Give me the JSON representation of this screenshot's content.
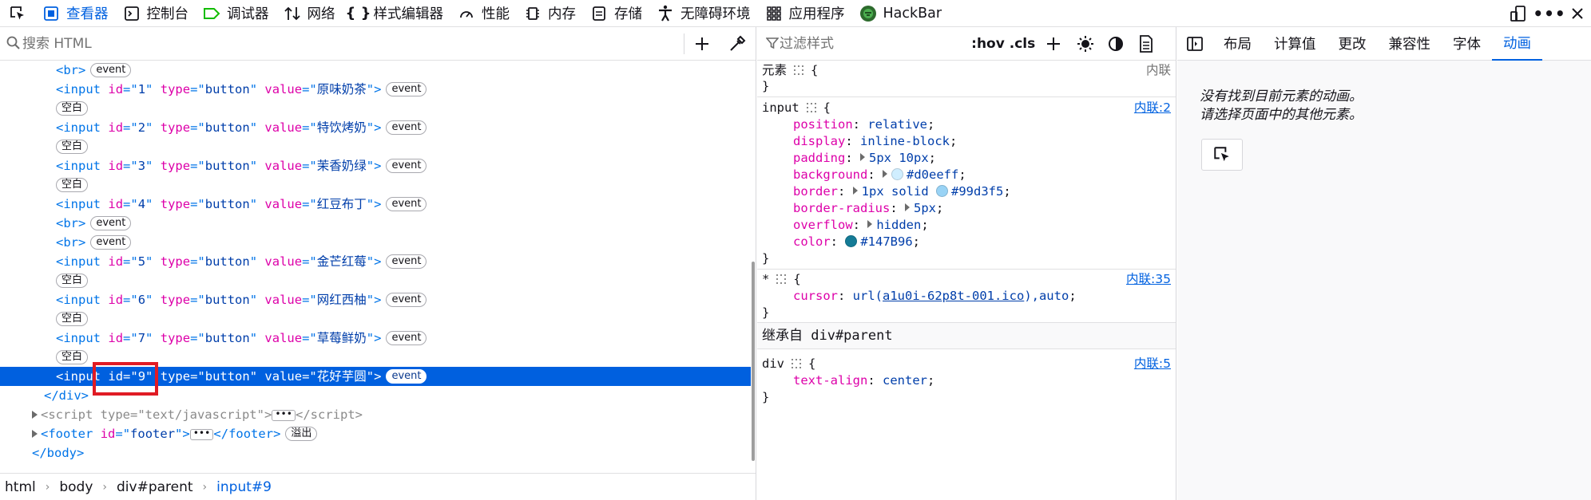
{
  "toolbar": {
    "tabs": [
      {
        "label": "查看器",
        "icon": "inspector-icon"
      },
      {
        "label": "控制台",
        "icon": "console-icon"
      },
      {
        "label": "调试器",
        "icon": "debugger-icon"
      },
      {
        "label": "网络",
        "icon": "network-icon"
      },
      {
        "label": "样式编辑器",
        "icon": "style-editor-icon"
      },
      {
        "label": "性能",
        "icon": "performance-icon"
      },
      {
        "label": "内存",
        "icon": "memory-icon"
      },
      {
        "label": "存储",
        "icon": "storage-icon"
      },
      {
        "label": "无障碍环境",
        "icon": "accessibility-icon"
      },
      {
        "label": "应用程序",
        "icon": "application-icon"
      },
      {
        "label": "HackBar",
        "icon": "hackbar-icon"
      }
    ],
    "active_tab": "查看器",
    "accent": "#0061e0"
  },
  "markup": {
    "search_placeholder": "搜索 HTML",
    "badge_event": "event",
    "badge_whitespace": "空白",
    "badge_overflow": "溢出",
    "rows": {
      "r0": {
        "tag": "br"
      },
      "r1": {
        "id": "1",
        "type": "button",
        "value": "原味奶茶"
      },
      "r2": {
        "id": "2",
        "type": "button",
        "value": "特饮烤奶"
      },
      "r3": {
        "id": "3",
        "type": "button",
        "value": "茉香奶绿"
      },
      "r4": {
        "id": "4",
        "type": "button",
        "value": "红豆布丁"
      },
      "r5": {
        "id": "5",
        "type": "button",
        "value": "金芒红莓"
      },
      "r6": {
        "id": "6",
        "type": "button",
        "value": "网红西柚"
      },
      "r7": {
        "id": "7",
        "type": "button",
        "value": "草莓鲜奶"
      },
      "r9": {
        "id": "9",
        "type": "button",
        "value": "花好芋圆"
      },
      "script_type": "text/javascript",
      "footer_id": "footer"
    },
    "selected_color": "#0060df"
  },
  "breadcrumbs": [
    "html",
    "body",
    "div#parent",
    "input#9"
  ],
  "rules": {
    "filter_placeholder": "过滤样式",
    "hov": ":hov",
    "cls": ".cls",
    "element_selector": "元素",
    "element_source": "内联",
    "input_rule": {
      "selector": "input",
      "source": "内联:2",
      "props": [
        {
          "name": "position",
          "value": "relative"
        },
        {
          "name": "display",
          "value": "inline-block"
        },
        {
          "name": "padding",
          "value": "5px 10px"
        },
        {
          "name": "background",
          "value": "#d0eeff",
          "swatch": "#d0eeff"
        },
        {
          "name": "border",
          "value_a": "1px solid",
          "value_b": "#99d3f5",
          "swatch": "#99d3f5"
        },
        {
          "name": "border-radius",
          "value": "5px"
        },
        {
          "name": "overflow",
          "value": "hidden"
        },
        {
          "name": "color",
          "value": "#147B96",
          "swatch": "#147B96"
        }
      ]
    },
    "star_rule": {
      "selector": "*",
      "source": "内联:35",
      "prop": "cursor",
      "url_fn": "url(",
      "url_link": "a1u0i-62p8t-001.ico",
      "url_tail": "),auto"
    },
    "inherited_label": "继承自 div#parent",
    "div_rule": {
      "selector": "div",
      "source": "内联:5",
      "prop": "text-align",
      "value": "center"
    }
  },
  "side": {
    "tabs": [
      "布局",
      "计算值",
      "更改",
      "兼容性",
      "字体",
      "动画"
    ],
    "active_tab": "动画",
    "message_line1": "没有找到目前元素的动画。",
    "message_line2": "请选择页面中的其他元素。"
  }
}
